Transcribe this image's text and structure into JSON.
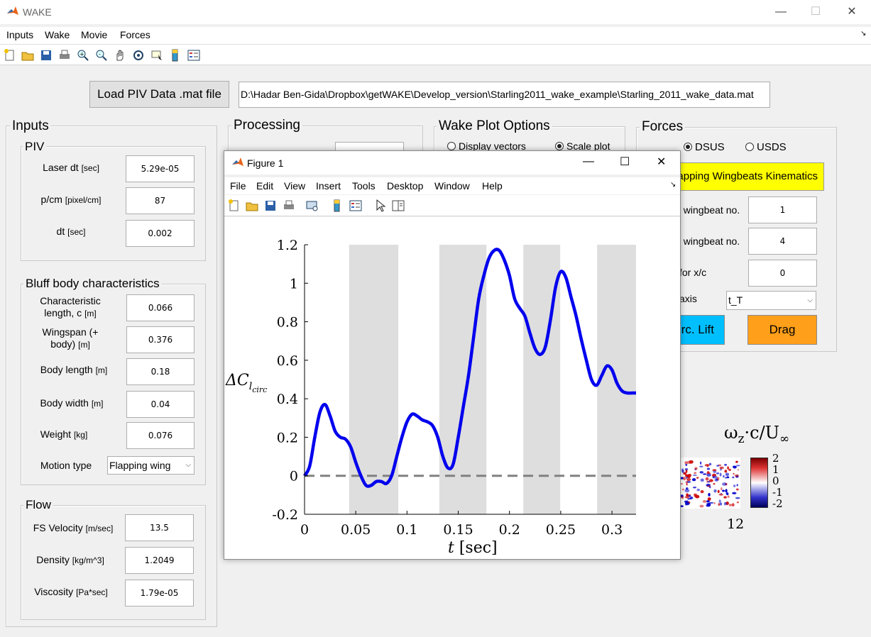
{
  "window": {
    "title": "WAKE",
    "minimize": "—",
    "maximize": "☐",
    "close": "✕"
  },
  "menu": [
    "Inputs",
    "Wake",
    "Movie",
    "Forces"
  ],
  "load_button": "Load PIV Data .mat file",
  "file_path": "D:\\Hadar Ben-Gida\\Dropbox\\getWAKE\\Develop_version\\Starling2011_wake_example\\Starling_2011_wake_data.mat",
  "inputs": {
    "title": "Inputs",
    "piv": {
      "title": "PIV",
      "laser_dt": {
        "label": "Laser dt",
        "unit": "[sec]",
        "value": "5.29e-05"
      },
      "p_cm": {
        "label": "p/cm",
        "unit": "[pixel/cm]",
        "value": "87"
      },
      "dt": {
        "label": "dt",
        "unit": "[sec]",
        "value": "0.002"
      }
    },
    "bluff": {
      "title": "Bluff body characteristics",
      "char_length": {
        "label1": "Characteristic",
        "label2": "length, c",
        "unit": "[m]",
        "value": "0.066"
      },
      "wingspan": {
        "label1": "Wingspan (+",
        "label2": "body)",
        "unit": "[m]",
        "value": "0.376"
      },
      "body_length": {
        "label": "Body length",
        "unit": "[m]",
        "value": "0.18"
      },
      "body_width": {
        "label": "Body width",
        "unit": "[m]",
        "value": "0.04"
      },
      "weight": {
        "label": "Weight",
        "unit": "[kg]",
        "value": "0.076"
      },
      "motion_type": {
        "label": "Motion type",
        "value": "Flapping wing"
      }
    },
    "flow": {
      "title": "Flow",
      "fs_velocity": {
        "label": "FS Velocity",
        "unit": "[m/sec]",
        "value": "13.5"
      },
      "density": {
        "label": "Density",
        "unit": "[kg/m^3]",
        "value": "1.2049"
      },
      "viscosity": {
        "label": "Viscosity",
        "unit": "[Pa*sec]",
        "value": "1.79e-05"
      }
    }
  },
  "processing": {
    "title": "Processing"
  },
  "wake_plot_options": {
    "title": "Wake Plot Options",
    "display_vectors": "Display vectors",
    "scale_plot": "Scale plot"
  },
  "forces": {
    "title": "Forces",
    "dsus": "DSUS",
    "usds": "USDS",
    "kinematics_button": "lapping Wingbeats Kinematics",
    "start_label": "t wingbeat no.",
    "start_value": "1",
    "end_label": "t wingbeat no.",
    "end_value": "4",
    "xc_label": "for x/c",
    "xc_value": "0",
    "axis_label": "axis",
    "axis_value": "t_T",
    "circ_lift_button": "rc. Lift",
    "drag_button": "Drag",
    "accent_yellow": "#ffff00",
    "accent_cyan": "#00bfff",
    "accent_orange": "#ff9f1a"
  },
  "colorbar": {
    "title_main": "ω",
    "title_sub": "z",
    "title_rest": "·c/U",
    "title_inf": "∞",
    "ticks": [
      "2",
      "1",
      "0",
      "-1",
      "-2"
    ],
    "x_tick": "12"
  },
  "figure": {
    "title": "Figure 1",
    "menu": [
      "File",
      "Edit",
      "View",
      "Insert",
      "Tools",
      "Desktop",
      "Window",
      "Help"
    ]
  },
  "chart_data": {
    "type": "line",
    "xlabel_var": "t",
    "xlabel_unit": "[sec]",
    "ylabel_main": "ΔC",
    "ylabel_sub": "l",
    "ylabel_subsub": "circ",
    "xlim": [
      0,
      0.3235
    ],
    "ylim": [
      -0.2,
      1.2
    ],
    "xticks": [
      "0",
      "0.05",
      "0.1",
      "0.15",
      "0.2",
      "0.25",
      "0.3"
    ],
    "xtick_values": [
      0,
      0.05,
      0.1,
      0.15,
      0.2,
      0.25,
      0.3
    ],
    "yticks": [
      "-0.2",
      "0",
      "0.2",
      "0.4",
      "0.6",
      "0.8",
      "1",
      "1.2"
    ],
    "ytick_values": [
      -0.2,
      0,
      0.2,
      0.4,
      0.6,
      0.8,
      1,
      1.2
    ],
    "shaded_bands": [
      [
        0.0435,
        0.0915
      ],
      [
        0.1315,
        0.1775
      ],
      [
        0.2135,
        0.2495
      ],
      [
        0.2855,
        0.3235
      ]
    ],
    "band_color": "#dedede",
    "line_color": "#0000ee",
    "baseline": 0,
    "x": [
      0,
      0.005,
      0.01,
      0.015,
      0.02,
      0.025,
      0.03,
      0.035,
      0.04,
      0.045,
      0.05,
      0.055,
      0.06,
      0.065,
      0.07,
      0.075,
      0.08,
      0.085,
      0.09,
      0.095,
      0.1,
      0.105,
      0.11,
      0.115,
      0.12,
      0.125,
      0.13,
      0.135,
      0.14,
      0.145,
      0.15,
      0.155,
      0.16,
      0.165,
      0.17,
      0.175,
      0.18,
      0.185,
      0.19,
      0.195,
      0.2,
      0.205,
      0.21,
      0.215,
      0.22,
      0.225,
      0.23,
      0.235,
      0.24,
      0.245,
      0.25,
      0.255,
      0.26,
      0.265,
      0.27,
      0.275,
      0.28,
      0.285,
      0.29,
      0.295,
      0.3,
      0.305,
      0.31,
      0.315,
      0.32,
      0.3235
    ],
    "y": [
      0.0,
      0.05,
      0.2,
      0.33,
      0.37,
      0.31,
      0.23,
      0.2,
      0.19,
      0.15,
      0.07,
      0.0,
      -0.05,
      -0.05,
      -0.03,
      -0.03,
      -0.04,
      0.0,
      0.1,
      0.2,
      0.28,
      0.32,
      0.31,
      0.29,
      0.28,
      0.26,
      0.2,
      0.1,
      0.04,
      0.06,
      0.2,
      0.36,
      0.52,
      0.72,
      0.92,
      1.04,
      1.13,
      1.17,
      1.17,
      1.12,
      1.04,
      0.92,
      0.87,
      0.83,
      0.74,
      0.66,
      0.63,
      0.67,
      0.81,
      0.98,
      1.06,
      1.03,
      0.93,
      0.83,
      0.71,
      0.6,
      0.5,
      0.47,
      0.52,
      0.57,
      0.55,
      0.48,
      0.44,
      0.43,
      0.43,
      0.43
    ]
  }
}
